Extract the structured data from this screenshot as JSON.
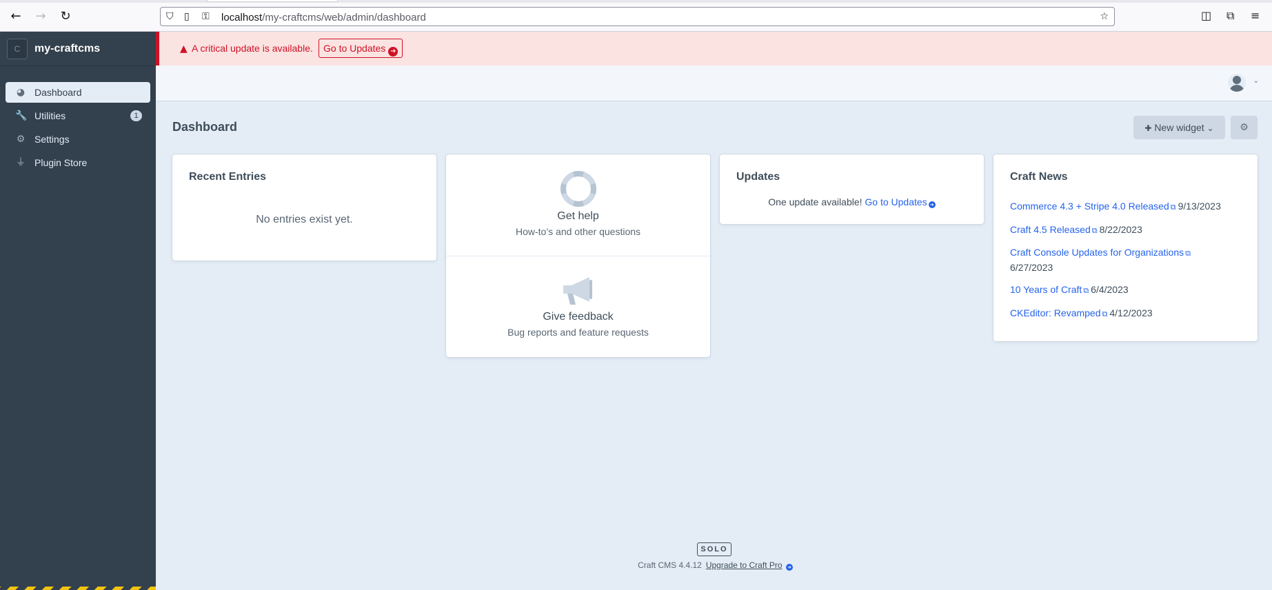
{
  "browser": {
    "url_host": "localhost",
    "url_path": "/my-craftcms/web/admin/dashboard"
  },
  "sidebar": {
    "site_name": "my-craftcms",
    "site_initial": "C",
    "items": [
      {
        "label": "Dashboard",
        "icon": "dashboard-icon",
        "active": true
      },
      {
        "label": "Utilities",
        "icon": "wrench-icon",
        "badge": "1"
      },
      {
        "label": "Settings",
        "icon": "gear-icon"
      },
      {
        "label": "Plugin Store",
        "icon": "plug-icon"
      }
    ]
  },
  "alert": {
    "message": "A critical update is available.",
    "button_label": "Go to Updates",
    "color": "#cf1124"
  },
  "header": {
    "title": "Dashboard",
    "new_widget_label": "New widget"
  },
  "widgets": {
    "recent_entries": {
      "title": "Recent Entries",
      "empty_text": "No entries exist yet."
    },
    "feedback": {
      "help_title": "Get help",
      "help_subtitle": "How-to’s and other questions",
      "feedback_title": "Give feedback",
      "feedback_subtitle": "Bug reports and feature requests"
    },
    "updates": {
      "title": "Updates",
      "text": "One update available!",
      "link": "Go to Updates"
    },
    "news": {
      "title": "Craft News",
      "items": [
        {
          "title": "Commerce 4.3 + Stripe 4.0 Released",
          "date": "9/13/2023"
        },
        {
          "title": "Craft 4.5 Released",
          "date": "8/22/2023"
        },
        {
          "title": "Craft Console Updates for Organizations",
          "date": "6/27/2023"
        },
        {
          "title": "10 Years of Craft",
          "date": "6/4/2023"
        },
        {
          "title": "CKEditor: Revamped",
          "date": "4/12/2023"
        }
      ]
    }
  },
  "footer": {
    "edition": "SOLO",
    "version": "Craft CMS 4.4.12",
    "upgrade_label": "Upgrade to Craft Pro"
  },
  "colors": {
    "sidebar_bg": "#33404d",
    "link": "#2563eb",
    "page_bg": "#e4edf6"
  }
}
